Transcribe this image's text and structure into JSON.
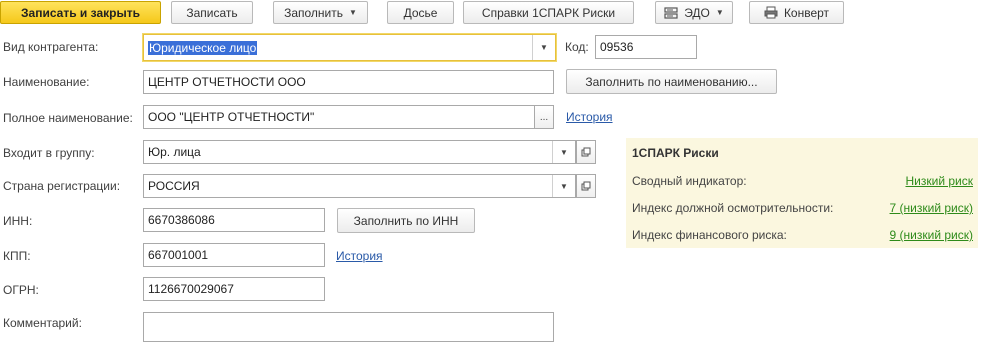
{
  "toolbar": {
    "save_close": "Записать и закрыть",
    "save": "Записать",
    "fill": "Заполнить",
    "dossier": "Досье",
    "spark": "Справки 1СПАРК Риски",
    "edo": "ЭДО",
    "envelope": "Конверт"
  },
  "form": {
    "kind_label": "Вид контрагента:",
    "kind_value": "Юридическое лицо",
    "code_label": "Код:",
    "code_value": "09536",
    "name_label": "Наименование:",
    "name_value": "ЦЕНТР ОТЧЕТНОСТИ ООО",
    "fill_by_name": "Заполнить по наименованию...",
    "full_name_label": "Полное наименование:",
    "full_name_value": "ООО \"ЦЕНТР ОТЧЕТНОСТИ\"",
    "ellipsis": "...",
    "history": "История",
    "group_label": "Входит в группу:",
    "group_value": "Юр. лица",
    "country_label": "Страна регистрации:",
    "country_value": "РОССИЯ",
    "inn_label": "ИНН:",
    "inn_value": "6670386086",
    "fill_by_inn": "Заполнить по ИНН",
    "kpp_label": "КПП:",
    "kpp_value": "667001001",
    "kpp_history": "История",
    "ogrn_label": "ОГРН:",
    "ogrn_value": "1126670029067",
    "comment_label": "Комментарий:"
  },
  "risk": {
    "title": "1СПАРК Риски",
    "rows": [
      {
        "label": "Сводный индикатор:",
        "value": "Низкий риск"
      },
      {
        "label": "Индекс должной осмотрительности:",
        "value": "7 (низкий риск)"
      },
      {
        "label": "Индекс финансового риска:",
        "value": "9 (низкий риск)"
      }
    ],
    "value_color": "#2e8b1a"
  },
  "icons": {
    "edo": "edo-icon",
    "printer": "printer-icon",
    "dropdown": "chevron-down-icon",
    "open": "open-form-icon"
  }
}
